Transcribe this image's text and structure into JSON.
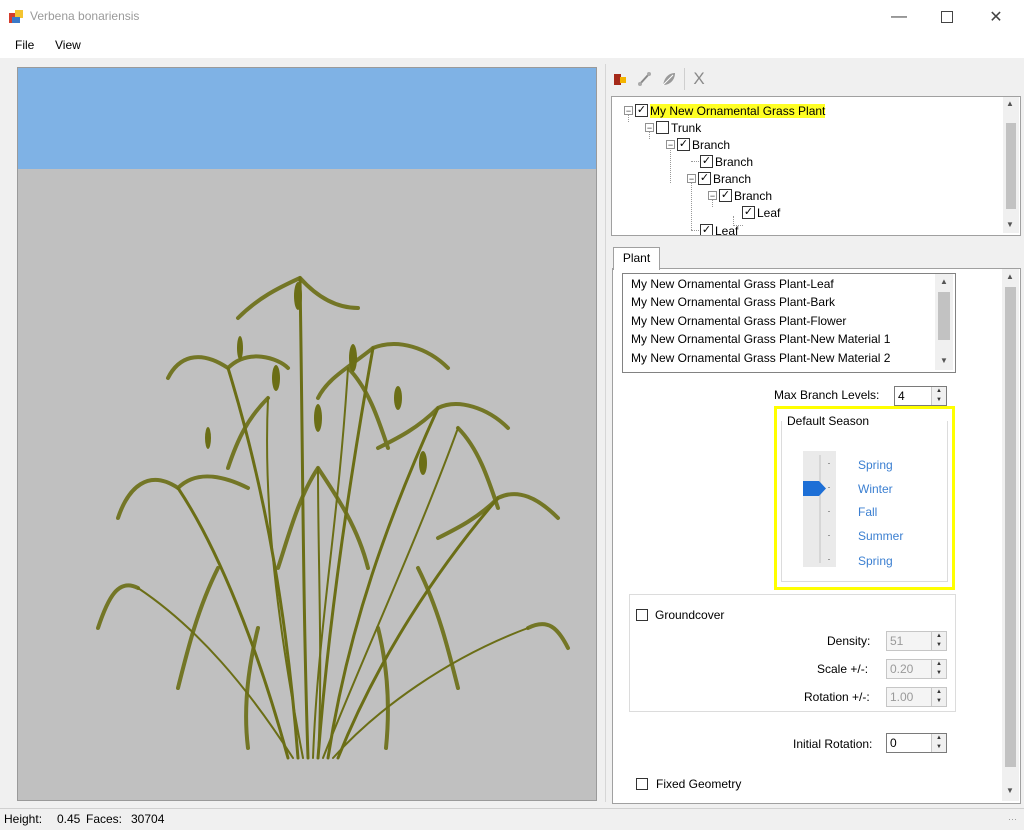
{
  "window": {
    "title": "Verbena bonariensis",
    "minimize": "—",
    "maximize": "☐",
    "close": "✕"
  },
  "menu": {
    "file": "File",
    "view": "View"
  },
  "toolbar": {
    "icons": [
      "plant-icon",
      "bone-icon",
      "leaf-icon",
      "delete-icon"
    ],
    "delete_glyph": "X"
  },
  "tree": {
    "root": "My New Ornamental Grass Plant",
    "trunk": "Trunk",
    "branch": "Branch",
    "leaf": "Leaf",
    "root_checked": "✓",
    "trunk_checked": "",
    "checked": "✓"
  },
  "tabs": {
    "plant": "Plant"
  },
  "materials": [
    "My New Ornamental Grass Plant-Leaf",
    "My New Ornamental Grass Plant-Bark",
    "My New Ornamental Grass Plant-Flower",
    "My New Ornamental Grass Plant-New Material 1",
    "My New Ornamental Grass Plant-New Material 2"
  ],
  "max_branch": {
    "label": "Max Branch Levels:",
    "value": "4"
  },
  "season": {
    "title": "Default Season",
    "labels": [
      "Spring",
      "Winter",
      "Fall",
      "Summer",
      "Spring"
    ],
    "selected_index": 1
  },
  "groundcover": {
    "label": "Groundcover",
    "density_label": "Density:",
    "density": "51",
    "scale_label": "Scale +/-:",
    "scale": "0.20",
    "rotation_label": "Rotation +/-:",
    "rotation": "1.00"
  },
  "initial_rotation": {
    "label": "Initial Rotation:",
    "value": "0"
  },
  "fixed_geometry": {
    "label": "Fixed Geometry"
  },
  "status": {
    "height_label": "Height:",
    "height": "0.45",
    "faces_label": "Faces:",
    "faces": "30704"
  },
  "colors": {
    "sky": "#7fb2e5",
    "ground": "#c0c0c0",
    "grass": "#6b6e16",
    "highlight": "#ffff00",
    "season_text": "#3b7fd1"
  }
}
